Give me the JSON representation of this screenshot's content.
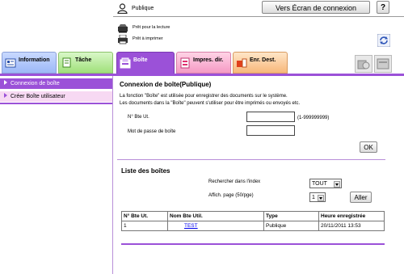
{
  "header": {
    "user_name": "Publique",
    "login_button": "Vers Écran de connexion",
    "help_button": "?",
    "status_read": "Prêt pour la lecture",
    "status_print": "Prêt à imprimer"
  },
  "tabs": [
    {
      "label": "Information"
    },
    {
      "label": "Tâche"
    },
    {
      "label": "Boîte"
    },
    {
      "label": "Impres. dir."
    },
    {
      "label": "Enr. Dest."
    }
  ],
  "sidebar": {
    "items": [
      {
        "label": "Connexion de boîte"
      },
      {
        "label": "Créer Boîte utilisateur"
      }
    ]
  },
  "login_section": {
    "title": "Connexion de boîte(Publique)",
    "desc_1": "La fonction \"Boîte\" est utilisée pour enregistrer des documents sur le système.",
    "desc_2": "Les documents dans la \"Boîte\" peuvent s'utiliser pour être imprimés ou envoyés etc.",
    "box_no_label": "N° Bte Ut.",
    "box_no_value": "",
    "box_no_range": "(1-999999999)",
    "password_label": "Mot de passe de boîte",
    "password_value": "",
    "ok_button": "OK"
  },
  "list_section": {
    "title": "Liste des boîtes",
    "search_label": "Rechercher dans l'index",
    "search_value": "TOUT",
    "page_label": "Affich. page (50/pge)",
    "page_value": "1",
    "go_button": "Aller",
    "columns": [
      "N° Bte Ut.",
      "Nom Bte Util.",
      "Type",
      "Heure enregistrée"
    ],
    "rows": [
      [
        "1",
        "TEST",
        "Publique",
        "20/11/2011 13:53"
      ]
    ]
  },
  "colors": {
    "accent_purple": "#9b51d8",
    "sidebar_inactive": "#f7d9f3"
  }
}
